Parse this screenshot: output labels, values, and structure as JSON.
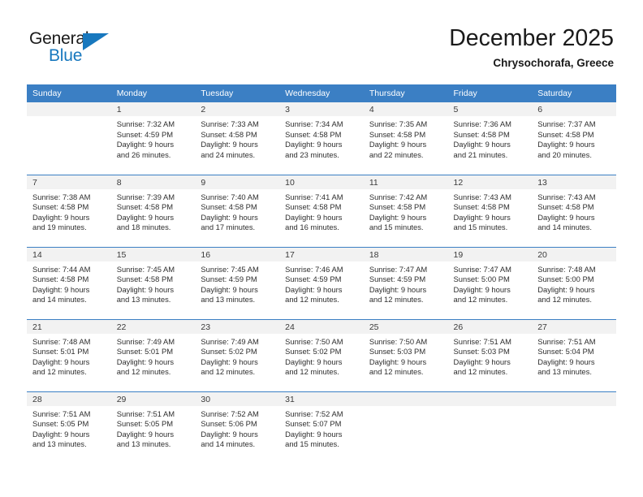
{
  "logo": {
    "word_top": "General",
    "word_bottom": "Blue",
    "accent_color": "#1878be",
    "triangle_icon": "triangle-icon"
  },
  "header": {
    "title": "December 2025",
    "location": "Chrysochorafa, Greece"
  },
  "calendar": {
    "header_bg": "#3b7fc4",
    "daynum_bg": "#f2f2f2",
    "weekday_headers": [
      "Sunday",
      "Monday",
      "Tuesday",
      "Wednesday",
      "Thursday",
      "Friday",
      "Saturday"
    ],
    "weeks": [
      [
        {
          "day": "",
          "sunrise": "",
          "sunset": "",
          "daylight_line1": "",
          "daylight_line2": ""
        },
        {
          "day": "1",
          "sunrise": "Sunrise: 7:32 AM",
          "sunset": "Sunset: 4:59 PM",
          "daylight_line1": "Daylight: 9 hours",
          "daylight_line2": "and 26 minutes."
        },
        {
          "day": "2",
          "sunrise": "Sunrise: 7:33 AM",
          "sunset": "Sunset: 4:58 PM",
          "daylight_line1": "Daylight: 9 hours",
          "daylight_line2": "and 24 minutes."
        },
        {
          "day": "3",
          "sunrise": "Sunrise: 7:34 AM",
          "sunset": "Sunset: 4:58 PM",
          "daylight_line1": "Daylight: 9 hours",
          "daylight_line2": "and 23 minutes."
        },
        {
          "day": "4",
          "sunrise": "Sunrise: 7:35 AM",
          "sunset": "Sunset: 4:58 PM",
          "daylight_line1": "Daylight: 9 hours",
          "daylight_line2": "and 22 minutes."
        },
        {
          "day": "5",
          "sunrise": "Sunrise: 7:36 AM",
          "sunset": "Sunset: 4:58 PM",
          "daylight_line1": "Daylight: 9 hours",
          "daylight_line2": "and 21 minutes."
        },
        {
          "day": "6",
          "sunrise": "Sunrise: 7:37 AM",
          "sunset": "Sunset: 4:58 PM",
          "daylight_line1": "Daylight: 9 hours",
          "daylight_line2": "and 20 minutes."
        }
      ],
      [
        {
          "day": "7",
          "sunrise": "Sunrise: 7:38 AM",
          "sunset": "Sunset: 4:58 PM",
          "daylight_line1": "Daylight: 9 hours",
          "daylight_line2": "and 19 minutes."
        },
        {
          "day": "8",
          "sunrise": "Sunrise: 7:39 AM",
          "sunset": "Sunset: 4:58 PM",
          "daylight_line1": "Daylight: 9 hours",
          "daylight_line2": "and 18 minutes."
        },
        {
          "day": "9",
          "sunrise": "Sunrise: 7:40 AM",
          "sunset": "Sunset: 4:58 PM",
          "daylight_line1": "Daylight: 9 hours",
          "daylight_line2": "and 17 minutes."
        },
        {
          "day": "10",
          "sunrise": "Sunrise: 7:41 AM",
          "sunset": "Sunset: 4:58 PM",
          "daylight_line1": "Daylight: 9 hours",
          "daylight_line2": "and 16 minutes."
        },
        {
          "day": "11",
          "sunrise": "Sunrise: 7:42 AM",
          "sunset": "Sunset: 4:58 PM",
          "daylight_line1": "Daylight: 9 hours",
          "daylight_line2": "and 15 minutes."
        },
        {
          "day": "12",
          "sunrise": "Sunrise: 7:43 AM",
          "sunset": "Sunset: 4:58 PM",
          "daylight_line1": "Daylight: 9 hours",
          "daylight_line2": "and 15 minutes."
        },
        {
          "day": "13",
          "sunrise": "Sunrise: 7:43 AM",
          "sunset": "Sunset: 4:58 PM",
          "daylight_line1": "Daylight: 9 hours",
          "daylight_line2": "and 14 minutes."
        }
      ],
      [
        {
          "day": "14",
          "sunrise": "Sunrise: 7:44 AM",
          "sunset": "Sunset: 4:58 PM",
          "daylight_line1": "Daylight: 9 hours",
          "daylight_line2": "and 14 minutes."
        },
        {
          "day": "15",
          "sunrise": "Sunrise: 7:45 AM",
          "sunset": "Sunset: 4:58 PM",
          "daylight_line1": "Daylight: 9 hours",
          "daylight_line2": "and 13 minutes."
        },
        {
          "day": "16",
          "sunrise": "Sunrise: 7:45 AM",
          "sunset": "Sunset: 4:59 PM",
          "daylight_line1": "Daylight: 9 hours",
          "daylight_line2": "and 13 minutes."
        },
        {
          "day": "17",
          "sunrise": "Sunrise: 7:46 AM",
          "sunset": "Sunset: 4:59 PM",
          "daylight_line1": "Daylight: 9 hours",
          "daylight_line2": "and 12 minutes."
        },
        {
          "day": "18",
          "sunrise": "Sunrise: 7:47 AM",
          "sunset": "Sunset: 4:59 PM",
          "daylight_line1": "Daylight: 9 hours",
          "daylight_line2": "and 12 minutes."
        },
        {
          "day": "19",
          "sunrise": "Sunrise: 7:47 AM",
          "sunset": "Sunset: 5:00 PM",
          "daylight_line1": "Daylight: 9 hours",
          "daylight_line2": "and 12 minutes."
        },
        {
          "day": "20",
          "sunrise": "Sunrise: 7:48 AM",
          "sunset": "Sunset: 5:00 PM",
          "daylight_line1": "Daylight: 9 hours",
          "daylight_line2": "and 12 minutes."
        }
      ],
      [
        {
          "day": "21",
          "sunrise": "Sunrise: 7:48 AM",
          "sunset": "Sunset: 5:01 PM",
          "daylight_line1": "Daylight: 9 hours",
          "daylight_line2": "and 12 minutes."
        },
        {
          "day": "22",
          "sunrise": "Sunrise: 7:49 AM",
          "sunset": "Sunset: 5:01 PM",
          "daylight_line1": "Daylight: 9 hours",
          "daylight_line2": "and 12 minutes."
        },
        {
          "day": "23",
          "sunrise": "Sunrise: 7:49 AM",
          "sunset": "Sunset: 5:02 PM",
          "daylight_line1": "Daylight: 9 hours",
          "daylight_line2": "and 12 minutes."
        },
        {
          "day": "24",
          "sunrise": "Sunrise: 7:50 AM",
          "sunset": "Sunset: 5:02 PM",
          "daylight_line1": "Daylight: 9 hours",
          "daylight_line2": "and 12 minutes."
        },
        {
          "day": "25",
          "sunrise": "Sunrise: 7:50 AM",
          "sunset": "Sunset: 5:03 PM",
          "daylight_line1": "Daylight: 9 hours",
          "daylight_line2": "and 12 minutes."
        },
        {
          "day": "26",
          "sunrise": "Sunrise: 7:51 AM",
          "sunset": "Sunset: 5:03 PM",
          "daylight_line1": "Daylight: 9 hours",
          "daylight_line2": "and 12 minutes."
        },
        {
          "day": "27",
          "sunrise": "Sunrise: 7:51 AM",
          "sunset": "Sunset: 5:04 PM",
          "daylight_line1": "Daylight: 9 hours",
          "daylight_line2": "and 13 minutes."
        }
      ],
      [
        {
          "day": "28",
          "sunrise": "Sunrise: 7:51 AM",
          "sunset": "Sunset: 5:05 PM",
          "daylight_line1": "Daylight: 9 hours",
          "daylight_line2": "and 13 minutes."
        },
        {
          "day": "29",
          "sunrise": "Sunrise: 7:51 AM",
          "sunset": "Sunset: 5:05 PM",
          "daylight_line1": "Daylight: 9 hours",
          "daylight_line2": "and 13 minutes."
        },
        {
          "day": "30",
          "sunrise": "Sunrise: 7:52 AM",
          "sunset": "Sunset: 5:06 PM",
          "daylight_line1": "Daylight: 9 hours",
          "daylight_line2": "and 14 minutes."
        },
        {
          "day": "31",
          "sunrise": "Sunrise: 7:52 AM",
          "sunset": "Sunset: 5:07 PM",
          "daylight_line1": "Daylight: 9 hours",
          "daylight_line2": "and 15 minutes."
        },
        {
          "day": "",
          "sunrise": "",
          "sunset": "",
          "daylight_line1": "",
          "daylight_line2": ""
        },
        {
          "day": "",
          "sunrise": "",
          "sunset": "",
          "daylight_line1": "",
          "daylight_line2": ""
        },
        {
          "day": "",
          "sunrise": "",
          "sunset": "",
          "daylight_line1": "",
          "daylight_line2": ""
        }
      ]
    ]
  }
}
